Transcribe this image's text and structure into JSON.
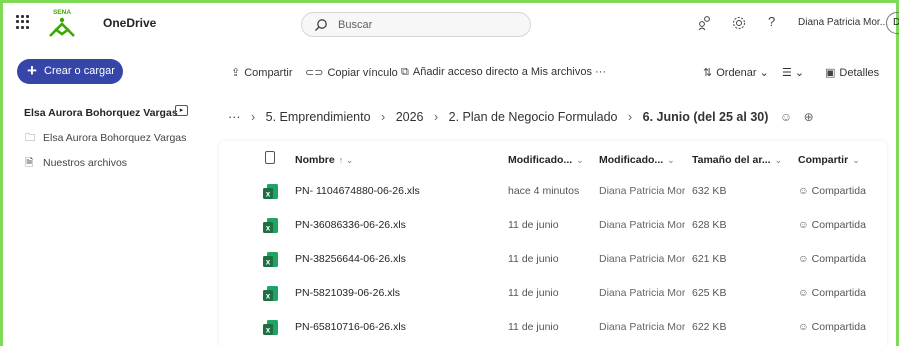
{
  "header": {
    "brand": "OneDrive",
    "search_placeholder": "Buscar",
    "user": "Diana Patricia Mor...",
    "avatar_initial": "D",
    "help": "?"
  },
  "sidebar": {
    "new_button": "Crear o cargar",
    "owner_title": "Elsa Aurora Bohorquez Vargas",
    "items": [
      {
        "label": "Elsa Aurora Bohorquez Vargas"
      },
      {
        "label": "Nuestros archivos"
      }
    ]
  },
  "commands": {
    "share": "Compartir",
    "copy_link": "Copiar vínculo",
    "add_shortcut": "Añadir acceso directo a Mis archivos",
    "more": "···",
    "sort": "Ordenar",
    "details": "Detalles"
  },
  "breadcrumb": {
    "ellipsis": "···",
    "items": [
      "5. Emprendimiento",
      "2026",
      "2. Plan de Negocio Formulado"
    ],
    "current": "6. Junio (del 25 al 30)"
  },
  "table": {
    "headers": {
      "name": "Nombre",
      "modified": "Modificado...",
      "modified_by": "Modificado...",
      "size": "Tamaño del ar...",
      "share": "Compartir"
    },
    "rows": [
      {
        "name": "PN- 1104674880-06-26.xls",
        "modified": "hace 4 minutos",
        "modified_by": "Diana Patricia Mora",
        "size": "632 KB",
        "share": "Compartida",
        "new": true
      },
      {
        "name": "PN-36086336-06-26.xls",
        "modified": "11 de junio",
        "modified_by": "Diana Patricia Mora",
        "size": "628 KB",
        "share": "Compartida"
      },
      {
        "name": "PN-38256644-06-26.xls",
        "modified": "11 de junio",
        "modified_by": "Diana Patricia Mora",
        "size": "621 KB",
        "share": "Compartida"
      },
      {
        "name": "PN-5821039-06-26.xls",
        "modified": "11 de junio",
        "modified_by": "Diana Patricia Mora",
        "size": "625 KB",
        "share": "Compartida"
      },
      {
        "name": "PN-65810716-06-26.xls",
        "modified": "11 de junio",
        "modified_by": "Diana Patricia Mora",
        "size": "622 KB",
        "share": "Compartida"
      }
    ]
  },
  "colors": {
    "accent": "#3545a8",
    "frame": "#7ed957",
    "excel": "#1d6f42",
    "sena": "#39a900"
  }
}
